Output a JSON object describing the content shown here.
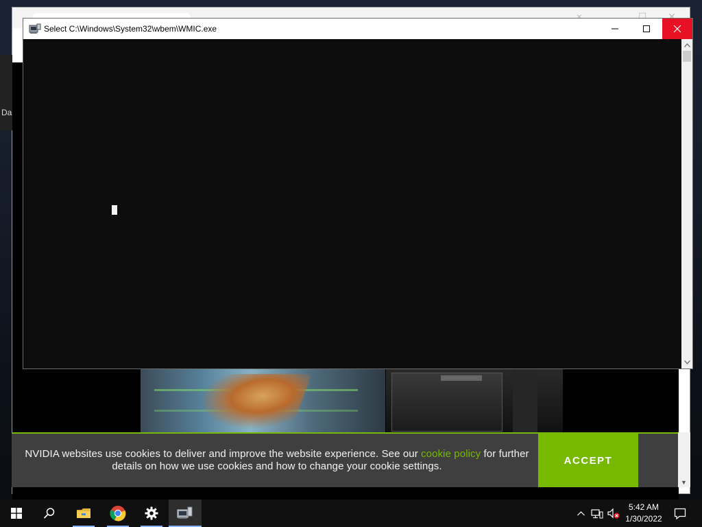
{
  "desktop": {
    "side_text": "Da"
  },
  "terminal": {
    "title": "Select C:\\Windows\\System32\\wbem\\WMIC.exe",
    "minimize_label": "Minimize",
    "maximize_label": "Maximize",
    "close_label": "Close"
  },
  "cookie_banner": {
    "text_before": "NVIDIA websites use cookies to deliver and improve the website experience. See our ",
    "link_text": "cookie policy",
    "text_after": " for further details on how we use cookies and how to change your cookie settings.",
    "accept_label": "ACCEPT"
  },
  "taskbar": {
    "apps": [
      "start-icon",
      "search-icon",
      "file-explorer-icon",
      "chrome-icon",
      "settings-icon",
      "wmic-icon"
    ],
    "clock_time": "5:42 AM",
    "clock_date": "1/30/2022"
  },
  "colors": {
    "nvidia_green": "#76b900",
    "close_red": "#e81123",
    "terminal_bg": "#0c0c0c"
  }
}
